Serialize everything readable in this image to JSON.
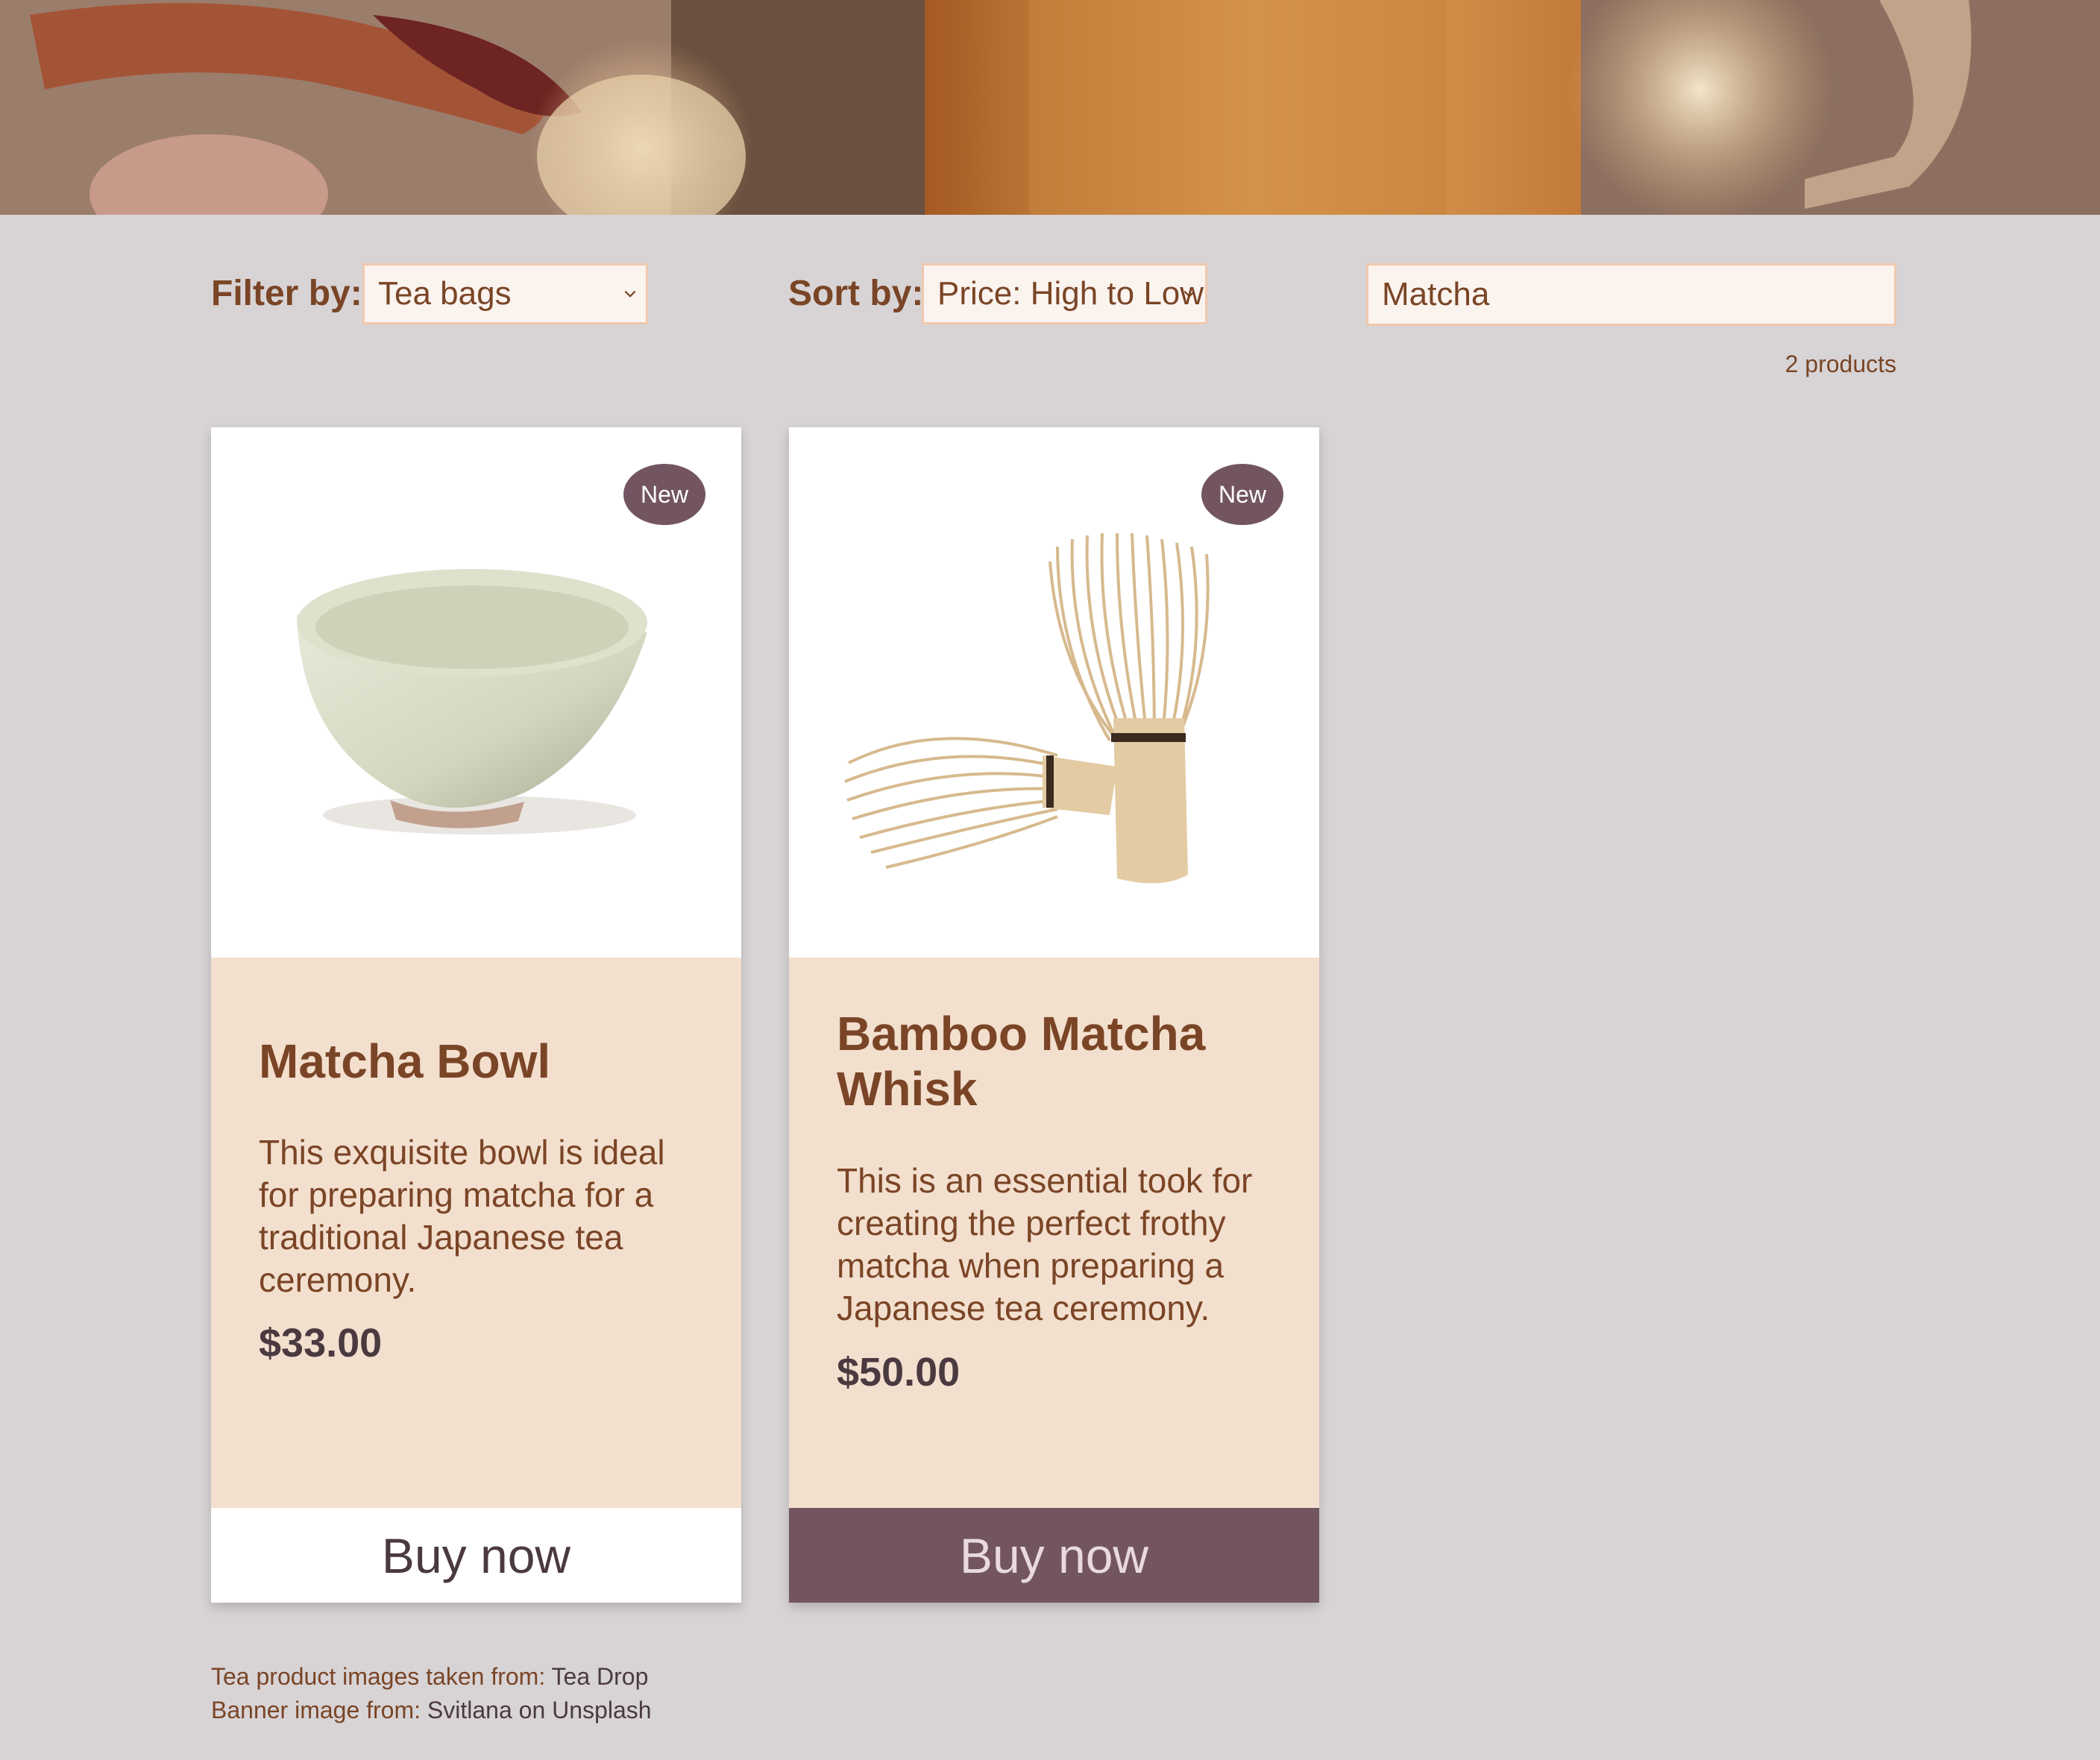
{
  "filters": {
    "filter_label": "Filter by:",
    "filter_value": "Tea bags",
    "sort_label": "Sort by:",
    "sort_value": "Price: High to Low",
    "search_value": "Matcha",
    "product_count": "2 products"
  },
  "products": [
    {
      "badge": "New",
      "title": "Matcha Bowl",
      "description": "This exquisite bowl is ideal for preparing matcha for a traditional Japanese tea ceremony.",
      "price": "$33.00",
      "button": "Buy now",
      "image_icon": "matcha-bowl-image"
    },
    {
      "badge": "New",
      "title": "Bamboo Matcha Whisk",
      "description": "This is an essential took for creating the perfect frothy matcha when preparing a Japanese tea ceremony.",
      "price": "$50.00",
      "button": "Buy now",
      "image_icon": "bamboo-whisk-image"
    }
  ],
  "footer": {
    "line1_prefix": "Tea product images taken from:",
    "line1_link": "Tea Drop",
    "line2_prefix": "Banner image from:",
    "line2_link": "Svitlana on Unsplash"
  },
  "colors": {
    "background": "#d8d4d6",
    "accent_brown": "#7a4526",
    "card_body": "#f3dfce",
    "badge": "#735562",
    "button_dark": "#735562"
  }
}
